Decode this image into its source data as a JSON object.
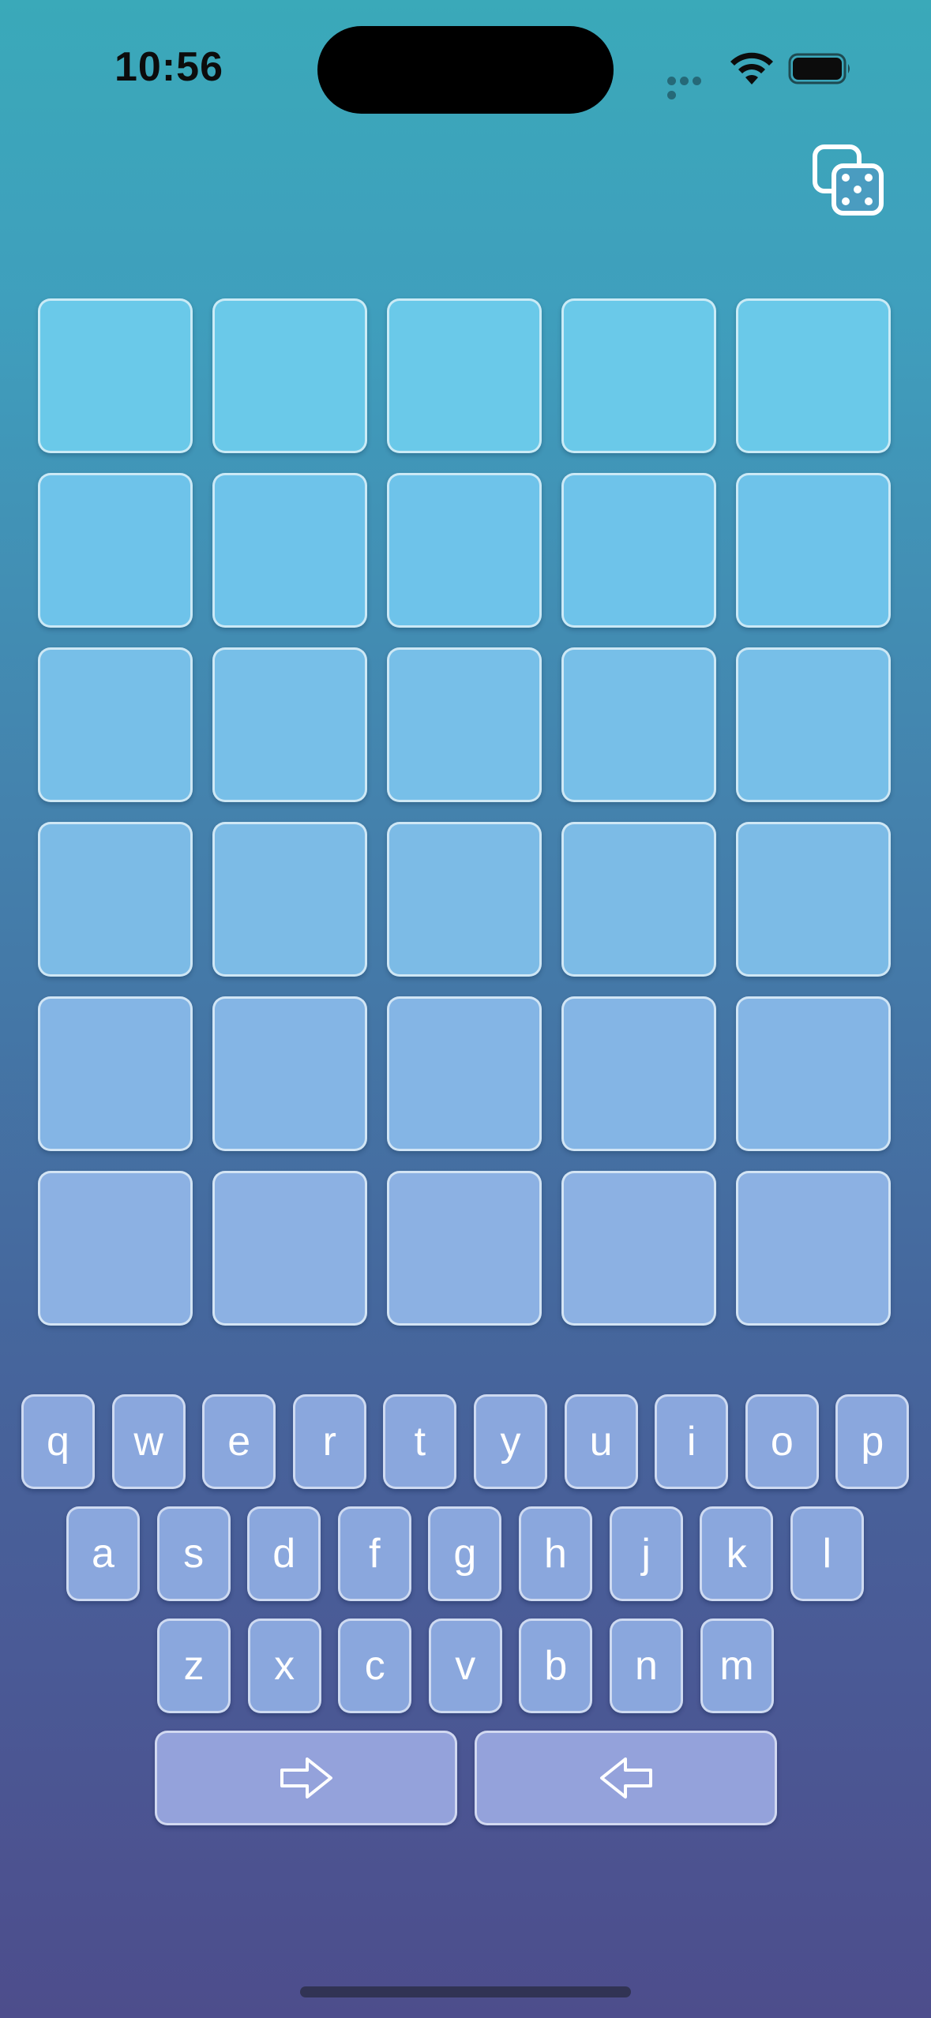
{
  "status_bar": {
    "time": "10:56"
  },
  "toolbar": {
    "random_icon": "dice-icon"
  },
  "board": {
    "rows": 6,
    "columns": 5,
    "tiles": [
      [
        "",
        "",
        "",
        "",
        ""
      ],
      [
        "",
        "",
        "",
        "",
        ""
      ],
      [
        "",
        "",
        "",
        "",
        ""
      ],
      [
        "",
        "",
        "",
        "",
        ""
      ],
      [
        "",
        "",
        "",
        "",
        ""
      ],
      [
        "",
        "",
        "",
        "",
        ""
      ]
    ],
    "row_colors": [
      "#6ac9e9",
      "#6ec3ea",
      "#77bfe8",
      "#7cbbe6",
      "#84b5e5",
      "#8cb1e3"
    ]
  },
  "keyboard": {
    "row1": [
      "q",
      "w",
      "e",
      "r",
      "t",
      "y",
      "u",
      "i",
      "o",
      "p"
    ],
    "row2": [
      "a",
      "s",
      "d",
      "f",
      "g",
      "h",
      "j",
      "k",
      "l"
    ],
    "row3": [
      "z",
      "x",
      "c",
      "v",
      "b",
      "n",
      "m"
    ],
    "action_keys": [
      {
        "icon": "arrow-right-icon"
      },
      {
        "icon": "arrow-left-icon"
      }
    ]
  }
}
